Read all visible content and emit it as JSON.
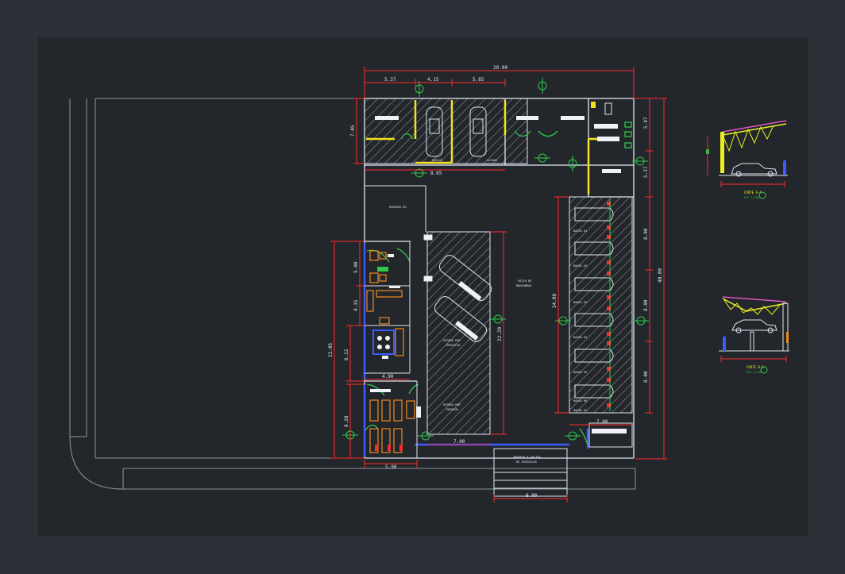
{
  "colors": {
    "background": "#2c2f35",
    "model_space": "#23272c",
    "wall": "#dfe6ee",
    "dimension": "#ff2a2a",
    "hatch": "#cfd6dc",
    "column_yellow": "#f2e21d",
    "door_green": "#2fc94a",
    "furniture_orange": "#f08a1e",
    "window_blue": "#3b5bff",
    "guide_line": "#8c949c",
    "roof_truss": "#e8f020",
    "roof_cover": "#ff5ad8"
  },
  "dimensions": {
    "overall_width": "20.00",
    "top_left": "5.37",
    "top_mid": "4.15",
    "top_right": "5.85",
    "top_height": "7.05",
    "top_under": "8.65",
    "right_upper": "5.97",
    "right_mid_small": "5.37",
    "right_a": "8.00",
    "right_b": "8.00",
    "right_c": "8.00",
    "right_total": "40.00",
    "stall_len": "24.00",
    "yard_len": "22.20",
    "bottom_stall": "7.00",
    "bottom_yard": "7.00",
    "left_total": "23.05",
    "left_office": "5.00",
    "left_mid": "4.35",
    "left_bath": "6.22",
    "left_work": "8.28",
    "office_width": "4.90",
    "work_width": "5.90",
    "entrance_width": "8.00"
  },
  "labels": {
    "parking": "PARQUEO DE",
    "yard": "PATIO DE",
    "yard2": "MANIOBRAS",
    "entrance": "INGRESO Y SALIDA",
    "entrance2": "DE VEHICULOS",
    "service_a": "ESPERA POR",
    "service_a2": "SERVICIO",
    "service_b": "ESPERA POR",
    "service_b2": "ENTREGA",
    "stall_1": "BAHIA 01",
    "stall_2": "BAHIA 02",
    "stall_3": "BAHIA 03",
    "stall_4": "BAHIA 04",
    "stall_5": "BAHIA 05",
    "stall_6": "BAHIA 06",
    "stall_7": "BAHIA 07",
    "garage_a": "GARAJE",
    "garage_b": "LAVADO"
  },
  "sections": [
    {
      "title": "CORTE A-A",
      "scale": "ESC 1/100"
    },
    {
      "title": "CORTE B-B",
      "scale": "ESC 1/100"
    }
  ]
}
